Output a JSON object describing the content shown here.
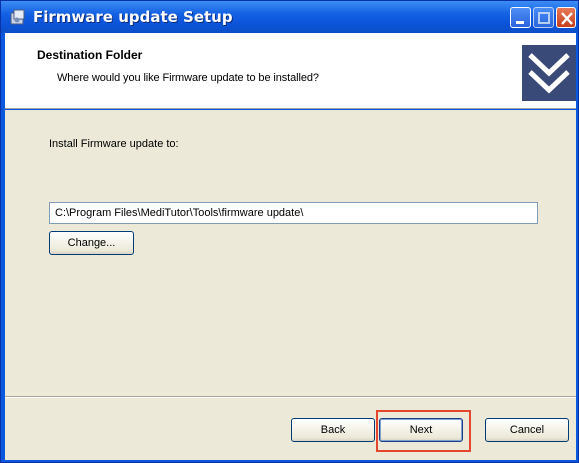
{
  "window": {
    "title": "Firmware update Setup"
  },
  "header": {
    "title": "Destination Folder",
    "subtitle": "Where would you like Firmware update to be installed?"
  },
  "body": {
    "install_label": "Install Firmware update to:",
    "path_value": "C:\\Program Files\\MediTutor\\Tools\\firmware update\\",
    "change_button": "Change..."
  },
  "footer": {
    "back_button": "Back",
    "next_button": "Next",
    "cancel_button": "Cancel"
  },
  "colors": {
    "titlebar": "#0b53d8",
    "dialog_face": "#ece9d8",
    "highlight": "#e3452e"
  }
}
